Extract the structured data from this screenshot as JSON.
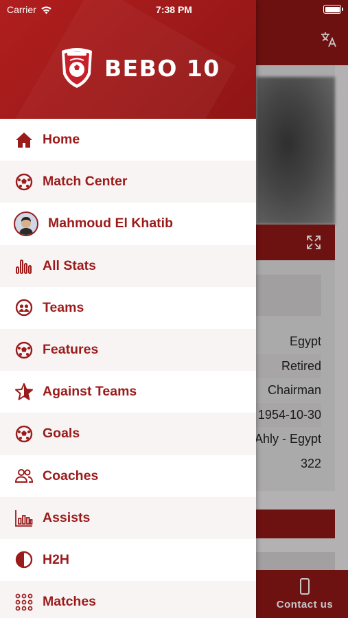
{
  "status_bar": {
    "carrier": "Carrier",
    "time": "7:38 PM"
  },
  "brand": {
    "name": "BEBO 10"
  },
  "colors": {
    "brand": "#9b1b1b",
    "header": "#a11a1a",
    "accent_dark": "#8e1717"
  },
  "menu": [
    {
      "label": "Home",
      "icon": "home-icon"
    },
    {
      "label": "Match Center",
      "icon": "football-icon"
    },
    {
      "label": "Mahmoud El Khatib",
      "icon": "avatar"
    },
    {
      "label": "All Stats",
      "icon": "stats-bars-icon"
    },
    {
      "label": "Teams",
      "icon": "team-icon"
    },
    {
      "label": "Features",
      "icon": "football-icon"
    },
    {
      "label": "Against Teams",
      "icon": "star-icon"
    },
    {
      "label": "Goals",
      "icon": "football-icon"
    },
    {
      "label": "Coaches",
      "icon": "users-icon"
    },
    {
      "label": "Assists",
      "icon": "bar-chart-icon"
    },
    {
      "label": "H2H",
      "icon": "half-circle-icon"
    },
    {
      "label": "Matches",
      "icon": "grid-dots-icon"
    }
  ],
  "background": {
    "info_rows": [
      "Egypt",
      "Retired",
      "Chairman",
      "1954-10-30",
      "Ahly - Egypt",
      "322"
    ],
    "contact_label": "Contact us"
  }
}
